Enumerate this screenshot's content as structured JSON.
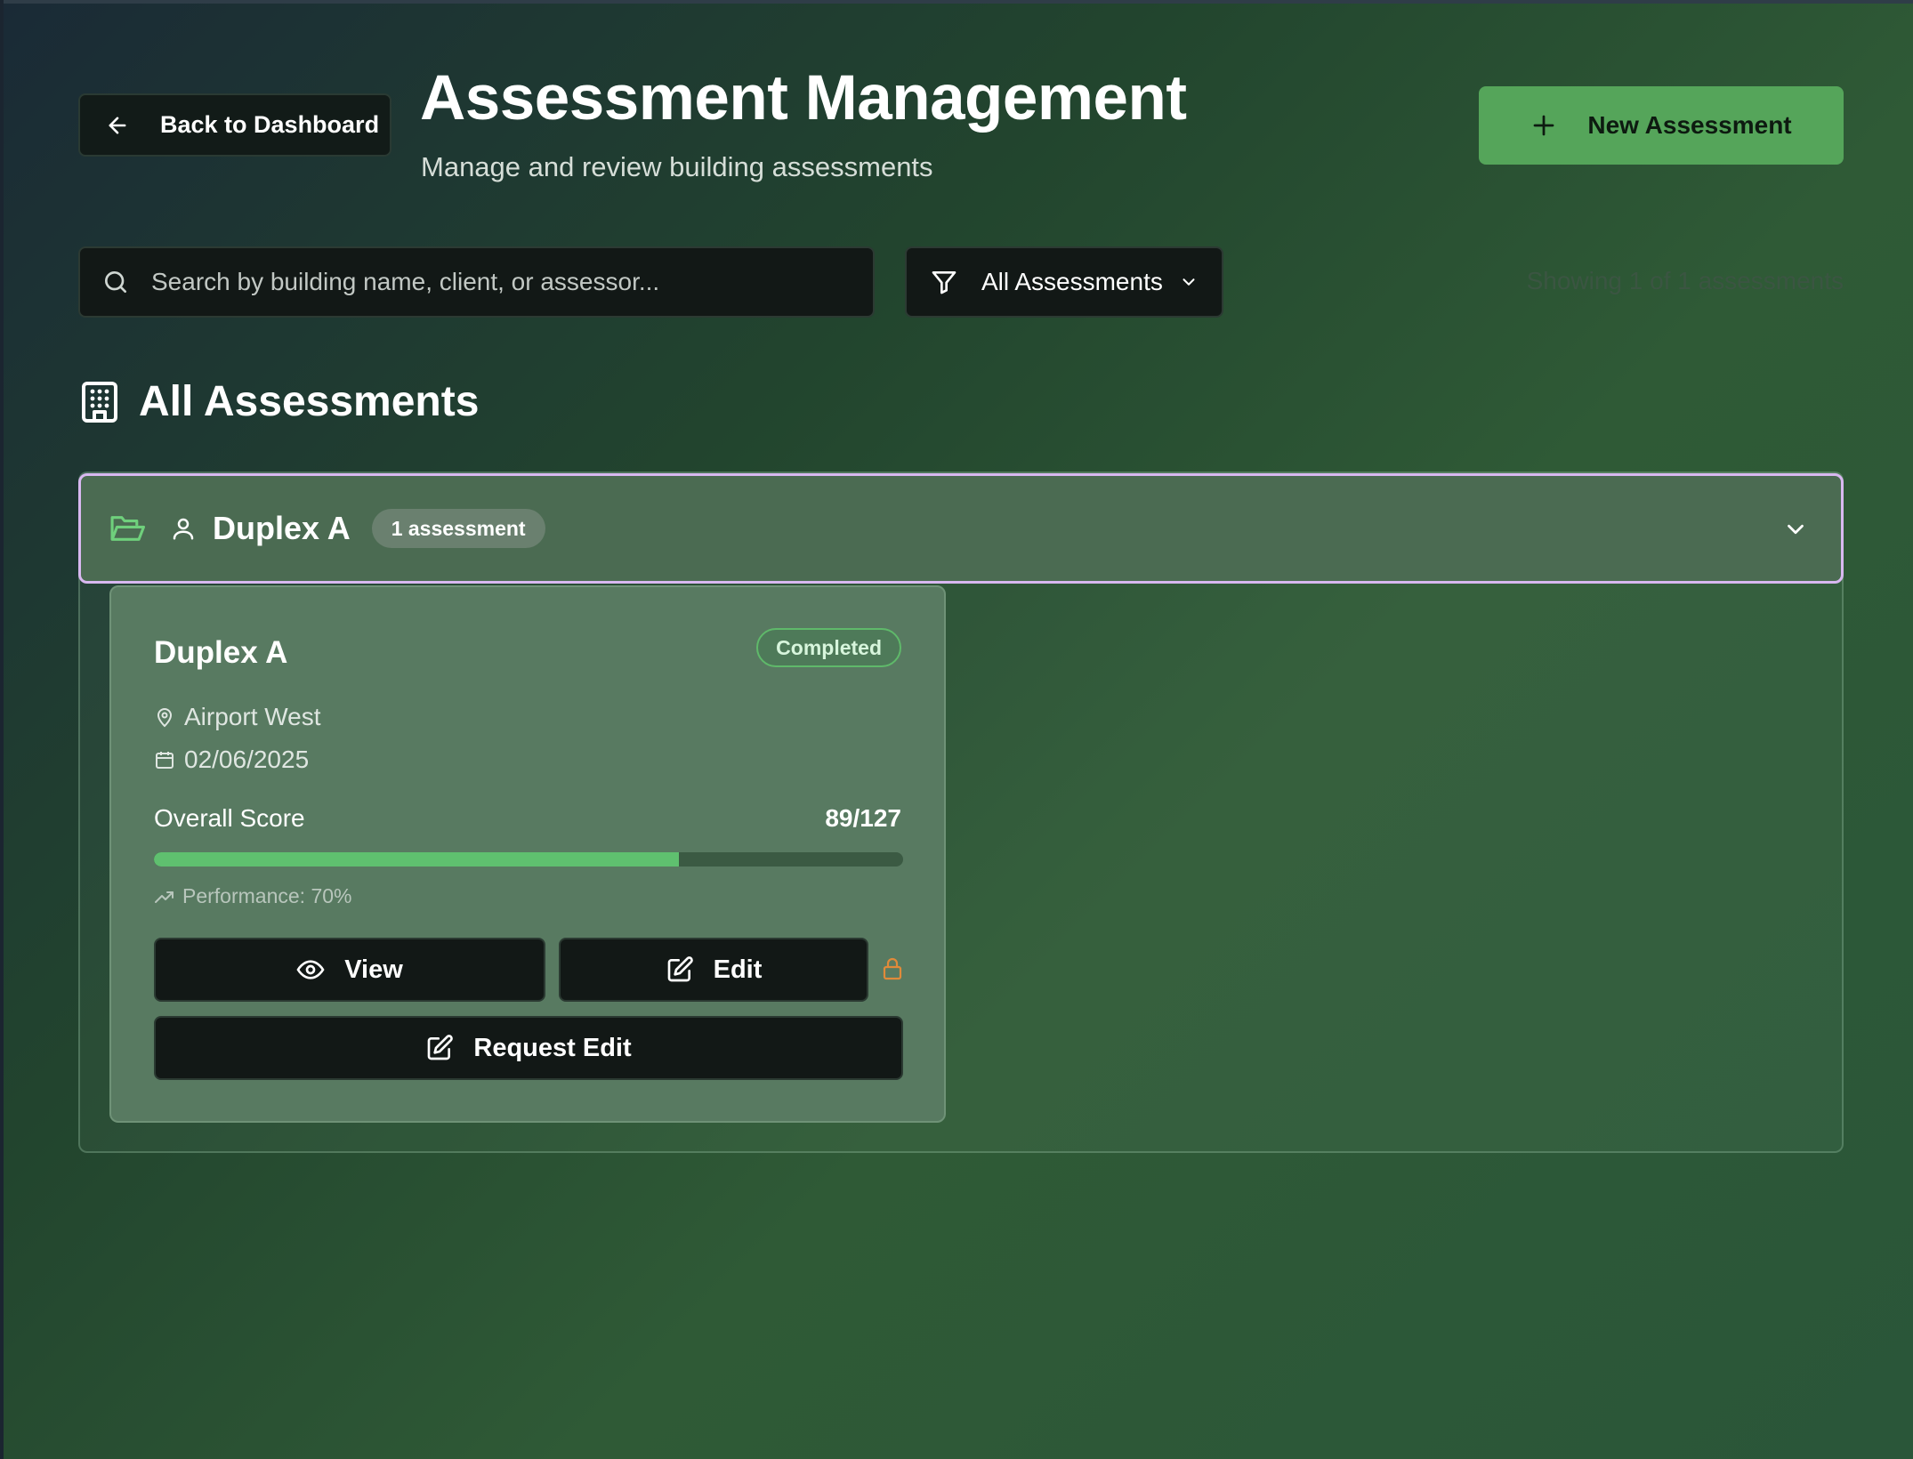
{
  "header": {
    "back_label": "Back to Dashboard",
    "title": "Assessment Management",
    "subtitle": "Manage and review building assessments",
    "new_label": "New Assessment"
  },
  "toolbar": {
    "search_placeholder": "Search by building name, client, or assessor...",
    "search_value": "",
    "filter_label": "All Assessments",
    "showing_text": "Showing 1 of 1 assessments"
  },
  "section": {
    "title": "All Assessments"
  },
  "group": {
    "name": "Duplex A",
    "badge": "1 assessment",
    "expanded": true
  },
  "cards": [
    {
      "title": "Duplex A",
      "status": "Completed",
      "location": "Airport West",
      "date": "02/06/2025",
      "score_label": "Overall Score",
      "score_value": "89/127",
      "score_fraction": 0.7008,
      "performance": "Performance: 70%",
      "view_label": "View",
      "edit_label": "Edit",
      "edit_locked": true,
      "request_label": "Request Edit"
    }
  ],
  "colors": {
    "accent": "#55a55a",
    "status_completed": "#5fb96a",
    "progress_fill": "#5fc06f",
    "lock": "#e08a3a",
    "group_border": "#d8b8f0"
  },
  "icons": [
    "arrow-left-icon",
    "plus-icon",
    "search-icon",
    "filter-icon",
    "chevron-down-icon",
    "building-icon",
    "folder-open-icon",
    "user-icon",
    "map-pin-icon",
    "calendar-icon",
    "trending-up-icon",
    "eye-icon",
    "edit-icon",
    "lock-icon"
  ]
}
